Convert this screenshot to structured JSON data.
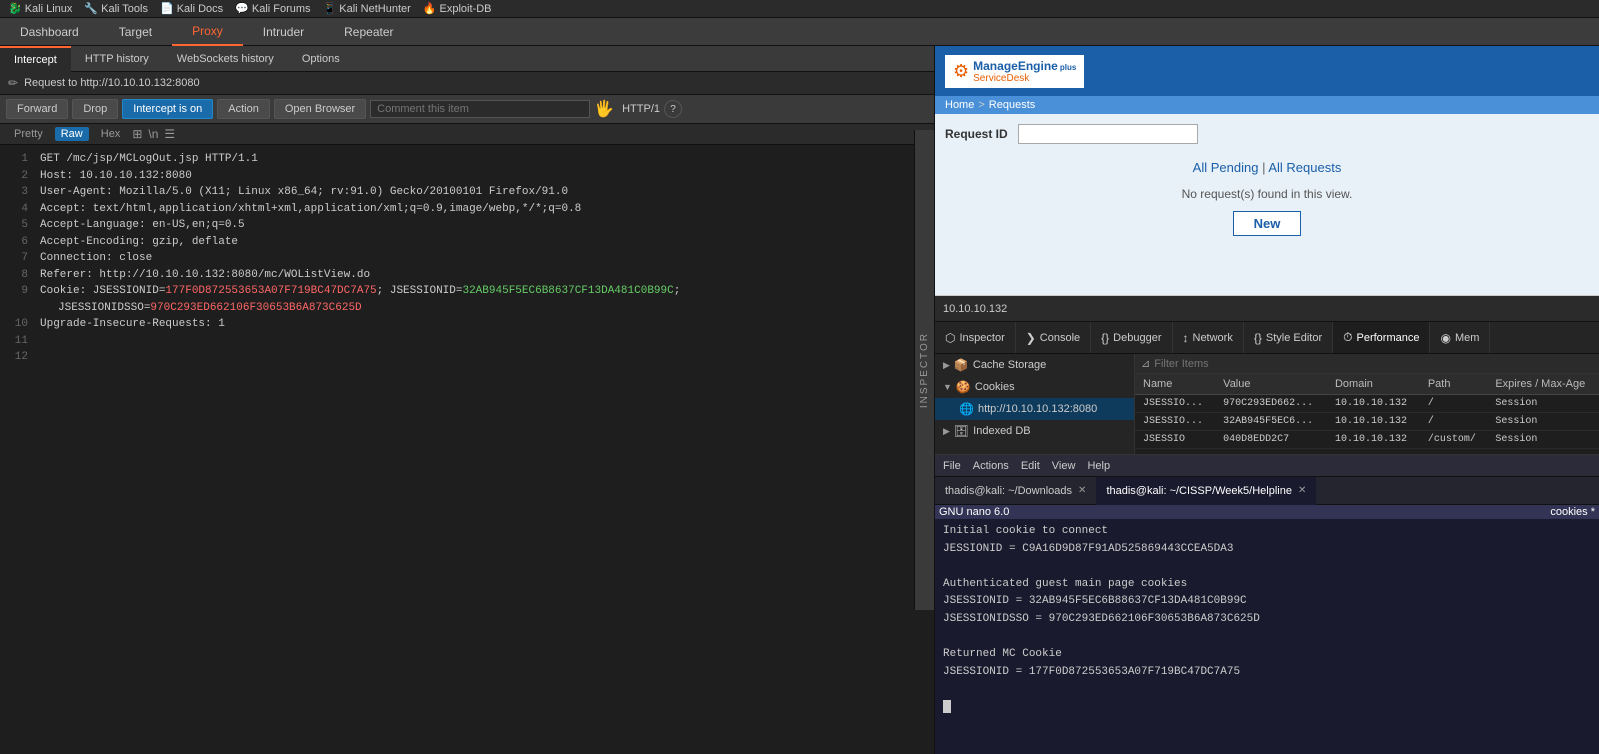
{
  "browser": {
    "bookmarks": [
      {
        "label": "Kali Linux",
        "icon": "🐉"
      },
      {
        "label": "Kali Tools",
        "icon": "🔧"
      },
      {
        "label": "Kali Docs",
        "icon": "📄"
      },
      {
        "label": "Kali Forums",
        "icon": "💬"
      },
      {
        "label": "Kali NetHunter",
        "icon": "📱"
      },
      {
        "label": "Exploit-DB",
        "icon": "🔥"
      }
    ]
  },
  "burp": {
    "nav": [
      "Dashboard",
      "Target",
      "Proxy",
      "Intruder",
      "Repeater"
    ],
    "active_nav": "Proxy",
    "tabs": [
      "Intercept",
      "HTTP history",
      "WebSockets history",
      "Options"
    ],
    "active_tab": "Intercept",
    "request_path": "Request to http://10.10.10.132:8080",
    "buttons": {
      "forward": "Forward",
      "drop": "Drop",
      "intercept_on": "Intercept is on",
      "action": "Action",
      "open_browser": "Open Browser",
      "comment_placeholder": "Comment this item",
      "http_label": "HTTP/1"
    },
    "format_buttons": [
      "Pretty",
      "Raw",
      "Hex"
    ],
    "active_format": "Raw",
    "request_lines": [
      "GET /mc/jsp/MCLogOut.jsp HTTP/1.1",
      "Host: 10.10.10.132:8080",
      "User-Agent: Mozilla/5.0 (X11; Linux x86_64; rv:91.0) Gecko/20100101 Firefox/91.0",
      "Accept: text/html,application/xhtml+xml,application/xml;q=0.9,image/webp,*/*;q=0.8",
      "Accept-Language: en-US,en;q=0.5",
      "Accept-Encoding: gzip, deflate",
      "Connection: close",
      "Referer: http://10.10.10.132:8080/mc/WOListView.do",
      "Cookie: JSESSIONID=177F0D872553653A07F719BC47DC7A75; JSESSIONID=32AB945F5EC6B8637CF13DA481C0B99C;",
      "  JSESSIONIDSSO=970C293ED662106F30653B6A873C625D",
      "Upgrade-Insecure-Requests: 1",
      "",
      ""
    ],
    "cookie_highlight_1": "177F0D872553653A07F719BC47DC7A75",
    "cookie_highlight_2": "32AB945F5EC6B8637CF13DA481C0B99C",
    "cookie_highlight_3": "970C293ED662106F30653B6A873C625D",
    "inspector_label": "INSPECTOR"
  },
  "manage_engine": {
    "logo_text": "ManageEngine",
    "logo_sub": "ServiceDesk",
    "logo_plus": "plus",
    "nav": {
      "home": "Home",
      "separator": ">",
      "requests": "Requests"
    },
    "request_id_label": "Request ID",
    "all_pending": "All Pending",
    "pipe": "|",
    "all_requests": "All Requests",
    "no_requests": "No request(s) found in this view.",
    "new_button": "New"
  },
  "devtools": {
    "address": "10.10.10.132",
    "tabs": [
      {
        "label": "Inspector",
        "icon": "⬡"
      },
      {
        "label": "Console",
        "icon": "❯"
      },
      {
        "label": "Debugger",
        "icon": "{}"
      },
      {
        "label": "Network",
        "icon": "↕"
      },
      {
        "label": "Style Editor",
        "icon": "{}"
      },
      {
        "label": "Performance",
        "icon": "⏱"
      },
      {
        "label": "Mem",
        "icon": "◉"
      }
    ],
    "active_tab": "Inspector",
    "storage": {
      "filter_placeholder": "Filter Items",
      "tree": [
        {
          "label": "Cache Storage",
          "expanded": false,
          "icon": "📦"
        },
        {
          "label": "Cookies",
          "expanded": true,
          "icon": "🍪"
        },
        {
          "label": "http://10.10.10.132:8080",
          "is_child": true,
          "selected": true,
          "icon": "🌐"
        },
        {
          "label": "Indexed DB",
          "expanded": false,
          "icon": "🗄"
        }
      ],
      "columns": [
        "Name",
        "Value",
        "Domain",
        "Path",
        "Expires / Max-Age"
      ],
      "rows": [
        {
          "name": "JSESSIO...",
          "value": "970C293ED662...",
          "domain": "10.10.10.132",
          "path": "/",
          "expires": "Session"
        },
        {
          "name": "JSESSIO...",
          "value": "32AB945F5EC6...",
          "domain": "10.10.10.132",
          "path": "/",
          "expires": "Session"
        },
        {
          "name": "JSESSIO",
          "value": "040D8EDD2C7",
          "domain": "10.10.10.132",
          "path": "/custom/",
          "expires": "Session"
        }
      ]
    }
  },
  "terminal": {
    "title": "thadis@kali: ~/CISSP/Week5/Helpline",
    "menubar": [
      "File",
      "Actions",
      "Edit",
      "View",
      "Help"
    ],
    "tabs": [
      {
        "label": "thadis@kali: ~/Downloads",
        "active": false
      },
      {
        "label": "thadis@kali: ~/CISSP/Week5/Helpline",
        "active": true
      }
    ],
    "nano_left": "GNU nano 6.0",
    "nano_right": "cookies *",
    "content": [
      "Initial cookie to connect",
      "JESSIONID = C9A16D9D87F91AD525869443CCEA5DA3",
      "",
      "Authenticated guest main page cookies",
      "JSESSIONID = 32AB945F5EC6B88637CF13DA481C0B99C",
      "JSESSIONIDSSO = 970C293ED662106F30653B6A873C625D",
      "",
      "Returned MC Cookie",
      "JSESSIONID = 177F0D872553653A07F719BC47DC7A75",
      ""
    ],
    "cursor": true
  }
}
